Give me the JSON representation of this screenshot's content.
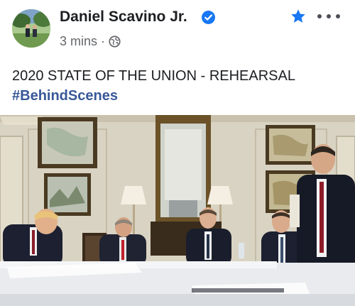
{
  "post": {
    "author": "Daniel Scavino Jr.",
    "timestamp": "3 mins",
    "separator": "·",
    "text": "2020 STATE OF THE UNION - REHEARSAL",
    "hashtag": "#BehindScenes"
  },
  "colors": {
    "accent": "#1877f2",
    "hashtag": "#385898",
    "meta": "#65676b"
  },
  "icons": {
    "verified": "verified-badge-icon",
    "privacy": "globe-icon",
    "favorite": "star-icon",
    "more": "more-dots-icon"
  }
}
